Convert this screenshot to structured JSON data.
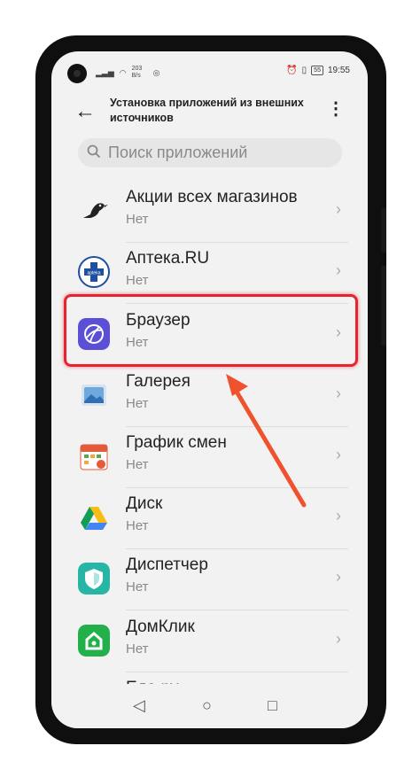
{
  "status_bar": {
    "speed": "203 B/s",
    "time": "19:55",
    "battery": "55"
  },
  "header": {
    "title": "Установка приложений из внешних источников"
  },
  "search": {
    "placeholder": "Поиск приложений"
  },
  "apps": [
    {
      "name": "Акции всех магазинов",
      "status": "Нет",
      "icon": "bird-icon"
    },
    {
      "name": "Аптека.RU",
      "status": "Нет",
      "icon": "apteka-icon"
    },
    {
      "name": "Браузер",
      "status": "Нет",
      "icon": "browser-icon"
    },
    {
      "name": "Галерея",
      "status": "Нет",
      "icon": "gallery-icon"
    },
    {
      "name": "График смен",
      "status": "Нет",
      "icon": "calendar-icon"
    },
    {
      "name": "Диск",
      "status": "Нет",
      "icon": "drive-icon"
    },
    {
      "name": "Диспетчер",
      "status": "Нет",
      "icon": "shield-icon"
    },
    {
      "name": "ДомКлик",
      "status": "Нет",
      "icon": "domclick-icon"
    },
    {
      "name": "Еда.ру",
      "status": "",
      "icon": ""
    }
  ],
  "colors": {
    "highlight": "#e8222e",
    "arrow": "#f0522e"
  }
}
